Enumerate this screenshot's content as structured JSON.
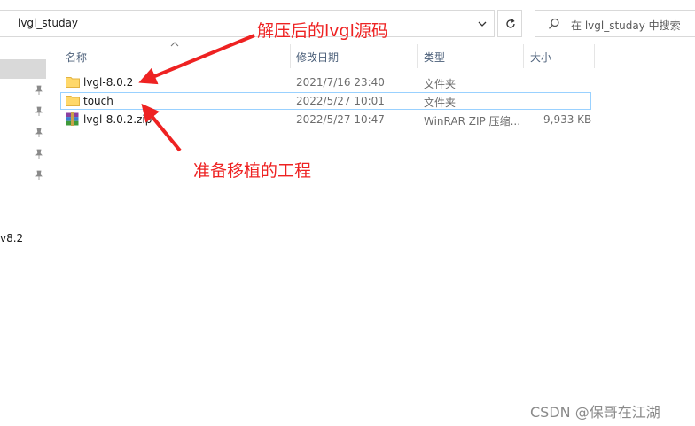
{
  "address_bar": {
    "path": "lvgl_studay"
  },
  "search": {
    "placeholder": "在 lvgl_studay 中搜索"
  },
  "nav_pane": {
    "partial_item_text": "v8.2"
  },
  "columns": {
    "name": "名称",
    "modified": "修改日期",
    "type": "类型",
    "size": "大小"
  },
  "files": [
    {
      "name": "lvgl-8.0.2",
      "modified": "2021/7/16 23:40",
      "type": "文件夹",
      "size": "",
      "icon": "folder-icon"
    },
    {
      "name": "touch",
      "modified": "2022/5/27 10:01",
      "type": "文件夹",
      "size": "",
      "icon": "folder-icon",
      "selected": true
    },
    {
      "name": "lvgl-8.0.2.zip",
      "modified": "2022/5/27 10:47",
      "type": "WinRAR ZIP 压缩...",
      "size": "9,933 KB",
      "icon": "winrar-zip-icon"
    }
  ],
  "annotations": {
    "top": "解压后的lvgl源码",
    "middle": "准备移植的工程",
    "color": "#ee2222"
  },
  "watermark": "CSDN @保哥在江湖",
  "colors": {
    "selection_border": "#99d1ff",
    "header_text": "#4c607a",
    "nav_selected": "#d9d9d9"
  }
}
